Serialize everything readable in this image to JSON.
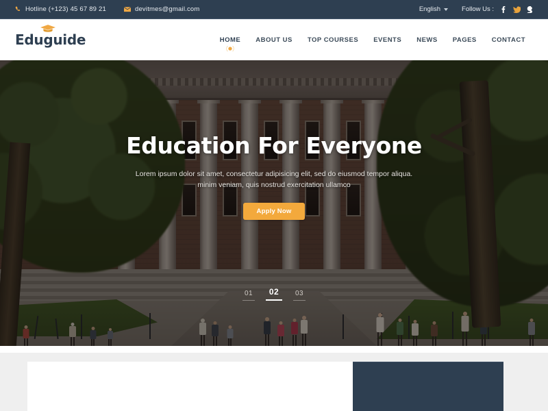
{
  "topbar": {
    "hotline": {
      "icon": "phone-icon",
      "text": "Hotline (+123) 45 67 89 21"
    },
    "email": {
      "icon": "envelope-icon",
      "text": "devitmes@gmail.com"
    },
    "language": {
      "selected": "English",
      "icon": "chevron-down-icon"
    },
    "follow_label": "Follow Us :",
    "socials": [
      {
        "name": "facebook-icon",
        "glyph": "f",
        "color": "#ffffff"
      },
      {
        "name": "twitter-icon",
        "glyph": "ᴠ",
        "color": "#e8a33d"
      },
      {
        "name": "google-plus-icon",
        "glyph": "g",
        "color": "#ffffff"
      }
    ],
    "bg_color": "#2e3f51",
    "accent_color": "#f0a844"
  },
  "header": {
    "logo_text": "Eduguide",
    "logo_icon": "graduation-cap-icon",
    "nav": [
      {
        "label": "HOME",
        "active": true
      },
      {
        "label": "ABOUT US",
        "active": false
      },
      {
        "label": "TOP COURSES",
        "active": false
      },
      {
        "label": "EVENTS",
        "active": false
      },
      {
        "label": "NEWS",
        "active": false
      },
      {
        "label": "PAGES",
        "active": false
      },
      {
        "label": "CONTACT",
        "active": false
      }
    ]
  },
  "hero": {
    "heading": "Education For Everyone",
    "paragraph": "Lorem ipsum dolor sit amet, consectetur adipisicing elit, sed do eiusmod tempor aliqua.  minim veniam, quis nostrud exercitation ullamco",
    "cta_label": "Apply Now",
    "cta_color": "#f3a93c",
    "slides": [
      {
        "number": "01",
        "active": false
      },
      {
        "number": "02",
        "active": true
      },
      {
        "number": "03",
        "active": false
      }
    ]
  },
  "below": {
    "section_bg": "#efefef",
    "card_light_color": "#ffffff",
    "card_dark_color": "#2e3f51"
  }
}
